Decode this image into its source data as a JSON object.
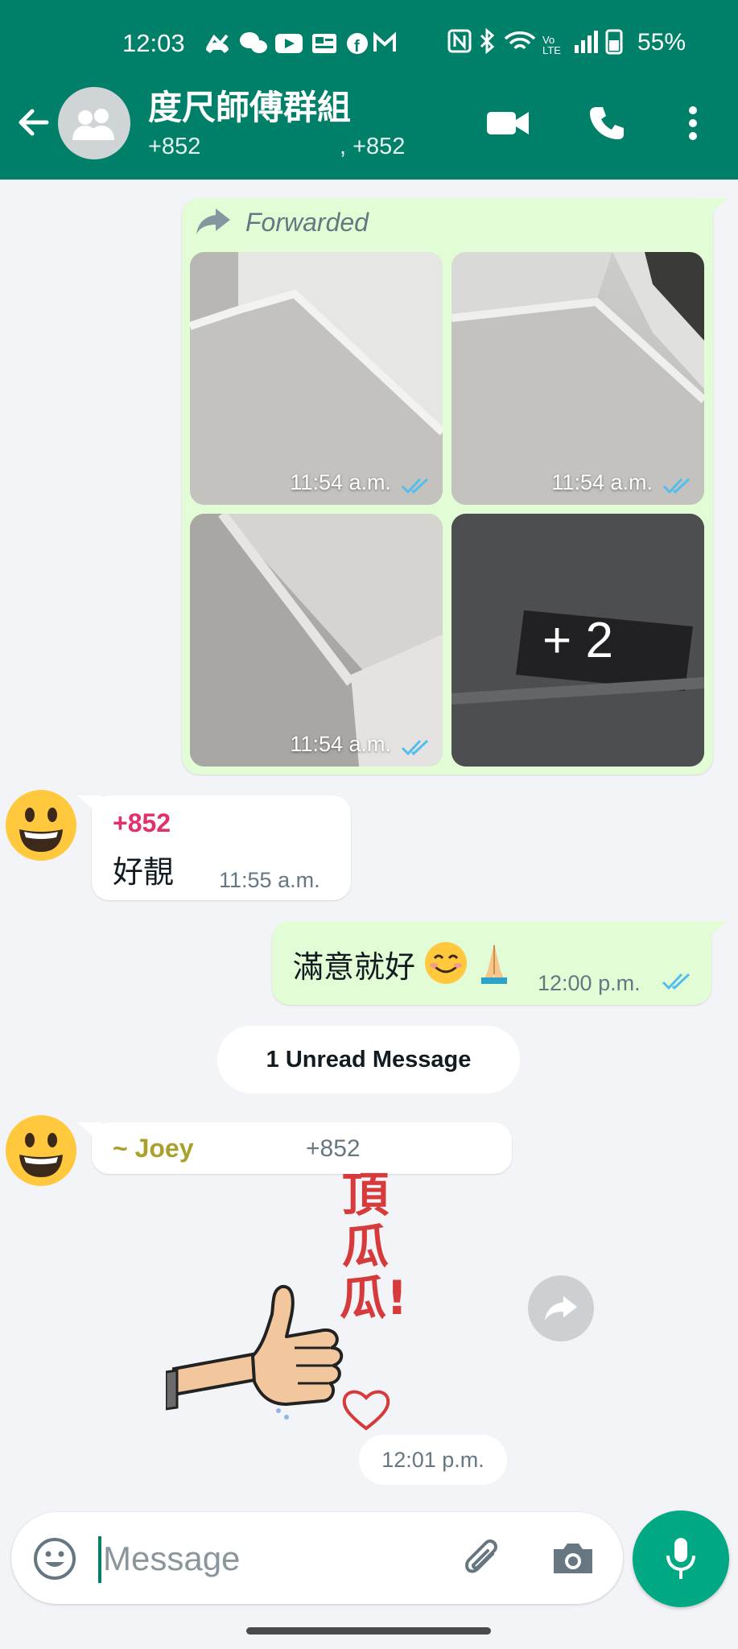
{
  "status_bar": {
    "time": "12:03",
    "battery": "55%",
    "icons": [
      "missed-call-icon",
      "wechat-icon",
      "youtube-icon",
      "news-icon",
      "facebook-icon",
      "gmail-icon",
      "nfc-icon",
      "bluetooth-icon",
      "wifi-icon",
      "volte-icon",
      "signal-icon",
      "battery-icon"
    ]
  },
  "header": {
    "title": "度尺師傅群組",
    "subtitle_left": "+852",
    "subtitle_right": ", +852",
    "accent": "#008069"
  },
  "album": {
    "forwarded_label": "Forwarded",
    "photos": [
      {
        "time": "11:54 a.m."
      },
      {
        "time": "11:54 a.m."
      },
      {
        "time": "11:54 a.m."
      }
    ],
    "more_count": "+ 2"
  },
  "messages": [
    {
      "sender": "+852",
      "text": "好靚",
      "time": "11:55 a.m.",
      "sender_color": "#e0306e"
    },
    {
      "text": "滿意就好",
      "emojis": [
        "smiling-face-icon",
        "folded-hands-icon"
      ],
      "time": "12:00 p.m.",
      "status": "read"
    },
    {
      "sender": "~ Joey",
      "phone": "+852",
      "sender_color": "#a9a12b"
    }
  ],
  "unread_label": "1 Unread Message",
  "sticker": {
    "text": "頂瓜瓜!",
    "time": "12:01 p.m."
  },
  "composer": {
    "placeholder": "Message"
  }
}
